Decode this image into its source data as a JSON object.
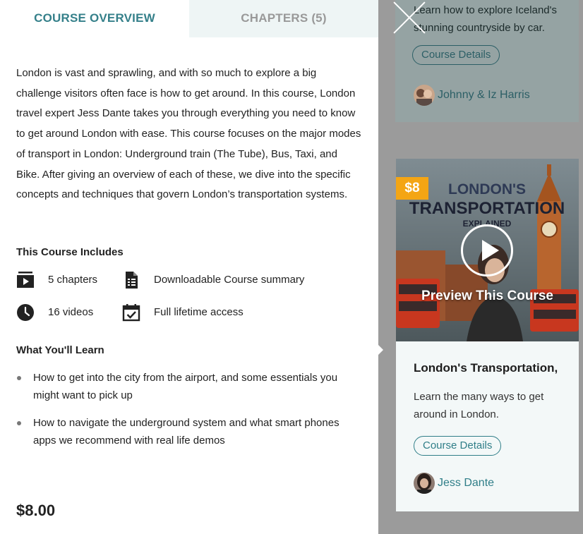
{
  "tabs": [
    {
      "label": "COURSE OVERVIEW",
      "active": true
    },
    {
      "label": "CHAPTERS (5)",
      "active": false
    }
  ],
  "overview": {
    "description": "London is vast and sprawling, and with so much to explore a big challenge visitors often face is how to get around. In this course, London travel expert Jess Dante takes you through everything you need to know to get around London with ease. This course focuses on the major modes of transport in London: Underground train (The Tube), Bus, Taxi, and Bike. After giving an overview of each of these, we dive into the specific concepts and techniques that govern London’s transportation systems.",
    "includes_title": "This Course Includes",
    "includes": [
      {
        "icon": "chapters-icon",
        "label": "5 chapters"
      },
      {
        "icon": "document-icon",
        "label": "Downloadable Course summary"
      },
      {
        "icon": "clock-icon",
        "label": "16 videos"
      },
      {
        "icon": "calendar-check-icon",
        "label": "Full lifetime access"
      }
    ],
    "learn_title": "What You'll Learn",
    "learn_items": [
      "How to get into the city from the airport, and some essentials you might want to pick up",
      "How to navigate the underground system and what smart phones apps we recommend with real life demos"
    ],
    "price": "$8.00"
  },
  "background_card_top": {
    "description": "Learn how to explore Iceland's stunning countryside by car.",
    "details_label": "Course Details",
    "author": "Johnny & Iz Harris"
  },
  "course_card": {
    "price_tag": "$8",
    "thumbnail_title_line1": "LONDON'S",
    "thumbnail_title_line2": "TRANSPORTATION",
    "thumbnail_title_line3": "EXPLAINED",
    "preview_label": "Preview This Course",
    "title": "London's Transportation,",
    "description": "Learn the many ways to get around in London.",
    "details_label": "Course Details",
    "author": "Jess Dante"
  },
  "colors": {
    "accent": "#35808a",
    "price_tag": "#f4a514",
    "tab_inactive_bg": "#eef5f5",
    "overlay": "#9b9b9b"
  }
}
